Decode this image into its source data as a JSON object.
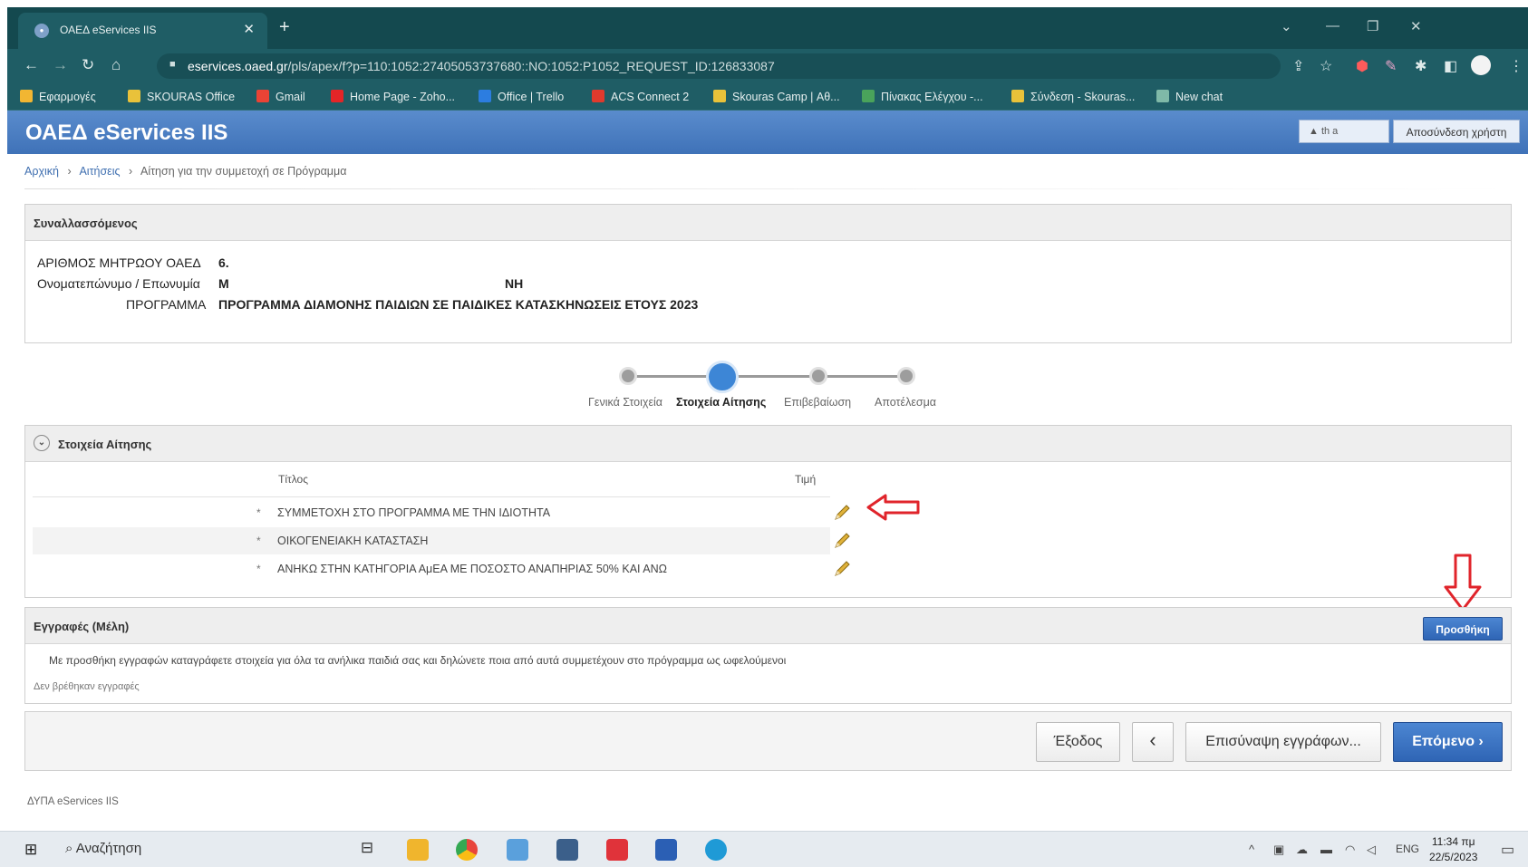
{
  "browser": {
    "tab_title": "ΟΑΕΔ eServices IIS",
    "tab_close": "✕",
    "new_tab": "+",
    "url_host": "eservices.oaed.gr",
    "url_path": "/pls/apex/f?p=110:1052:27405053737680::NO:1052:P1052_REQUEST_ID:126833087",
    "bookmarks": [
      {
        "label": "Εφαρμογές",
        "color": "#f2b632"
      },
      {
        "label": "SKOURAS Office",
        "color": "#e9c23a"
      },
      {
        "label": "Gmail",
        "color": "#ea4335"
      },
      {
        "label": "Home Page - Zoho...",
        "color": "#e42527"
      },
      {
        "label": "Office | Trello",
        "color": "#2c7de0"
      },
      {
        "label": "ACS Connect 2",
        "color": "#e03a2d"
      },
      {
        "label": "Skouras Camp | Αθ...",
        "color": "#e9c23a"
      },
      {
        "label": "Πίνακας Ελέγχου -...",
        "color": "#4aa35b"
      },
      {
        "label": "Σύνδεση - Skouras...",
        "color": "#e9c23a"
      },
      {
        "label": "New chat",
        "color": "#7fb9a8"
      }
    ]
  },
  "app": {
    "title": "ΟΑΕΔ eServices IIS",
    "user_label": "th          a",
    "logout_label": "Αποσύνδεση χρήστη"
  },
  "breadcrumb": {
    "home": "Αρχική",
    "applications": "Αιτήσεις",
    "current": "Αίτηση για την συμμετοχή σε Πρόγραμμα",
    "separator": "›"
  },
  "transactor": {
    "header": "Συναλλασσόμενος",
    "registry_label": "ΑΡΙΘΜΟΣ ΜΗΤΡΩΟΥ ΟΑΕΔ",
    "registry_value": "6.",
    "name_label": "Ονοματεπώνυμο / Επωνυμία",
    "name_value_start": "M",
    "name_value_end": "NH",
    "program_label": "ΠΡΟΓΡΑΜΜΑ",
    "program_value": "ΠΡΟΓΡΑΜΜΑ ΔΙΑΜΟΝΗΣ ΠΑΙΔΙΩΝ ΣΕ ΠΑΙΔΙΚΕΣ ΚΑΤΑΣΚΗΝΩΣΕΙΣ ΕΤΟΥΣ 2023"
  },
  "wizard": {
    "steps": [
      {
        "label": "Γενικά Στοιχεία",
        "active": false
      },
      {
        "label": "Στοιχεία Αίτησης",
        "active": true
      },
      {
        "label": "Επιβεβαίωση",
        "active": false
      },
      {
        "label": "Αποτέλεσμα",
        "active": false
      }
    ]
  },
  "application_details": {
    "header": "Στοιχεία Αίτησης",
    "columns": [
      "Τίτλος",
      "Τιμή"
    ],
    "rows": [
      {
        "marker": "*",
        "title": "ΣΥΜΜΕΤΟΧΗ ΣΤΟ ΠΡΟΓΡΑΜΜΑ ΜΕ ΤΗΝ ΙΔΙΟΤΗΤΑ"
      },
      {
        "marker": "*",
        "title": "ΟΙΚΟΓΕΝΕΙΑΚΗ ΚΑΤΑΣΤΑΣΗ"
      },
      {
        "marker": "*",
        "title": "ΑΝΗΚΩ ΣΤΗΝ ΚΑΤΗΓΟΡΙΑ ΑμΕΑ ΜΕ ΠΟΣΟΣΤΟ ΑΝΑΠΗΡΙΑΣ 50% ΚΑΙ ΑΝΩ"
      }
    ]
  },
  "members": {
    "header": "Εγγραφές (Μέλη)",
    "add_label": "Προσθήκη",
    "description": "Με προσθήκη εγγραφών καταγράφετε στοιχεία για όλα τα ανήλικα παιδιά σας και δηλώνετε ποια από αυτά συμμετέχουν στο πρόγραμμα ως ωφελούμενοι",
    "empty_text": "Δεν βρέθηκαν εγγραφές"
  },
  "actions": {
    "exit_label": "Έξοδος",
    "back_label": "‹",
    "attach_label": "Επισύναψη εγγράφων...",
    "next_label": "Επόμενο ›"
  },
  "footer": {
    "text": "ΔΥΠΑ eServices IIS"
  },
  "taskbar": {
    "search_label": "Αναζήτηση",
    "language": "ENG",
    "time": "11:34 πμ",
    "date": "22/5/2023"
  }
}
